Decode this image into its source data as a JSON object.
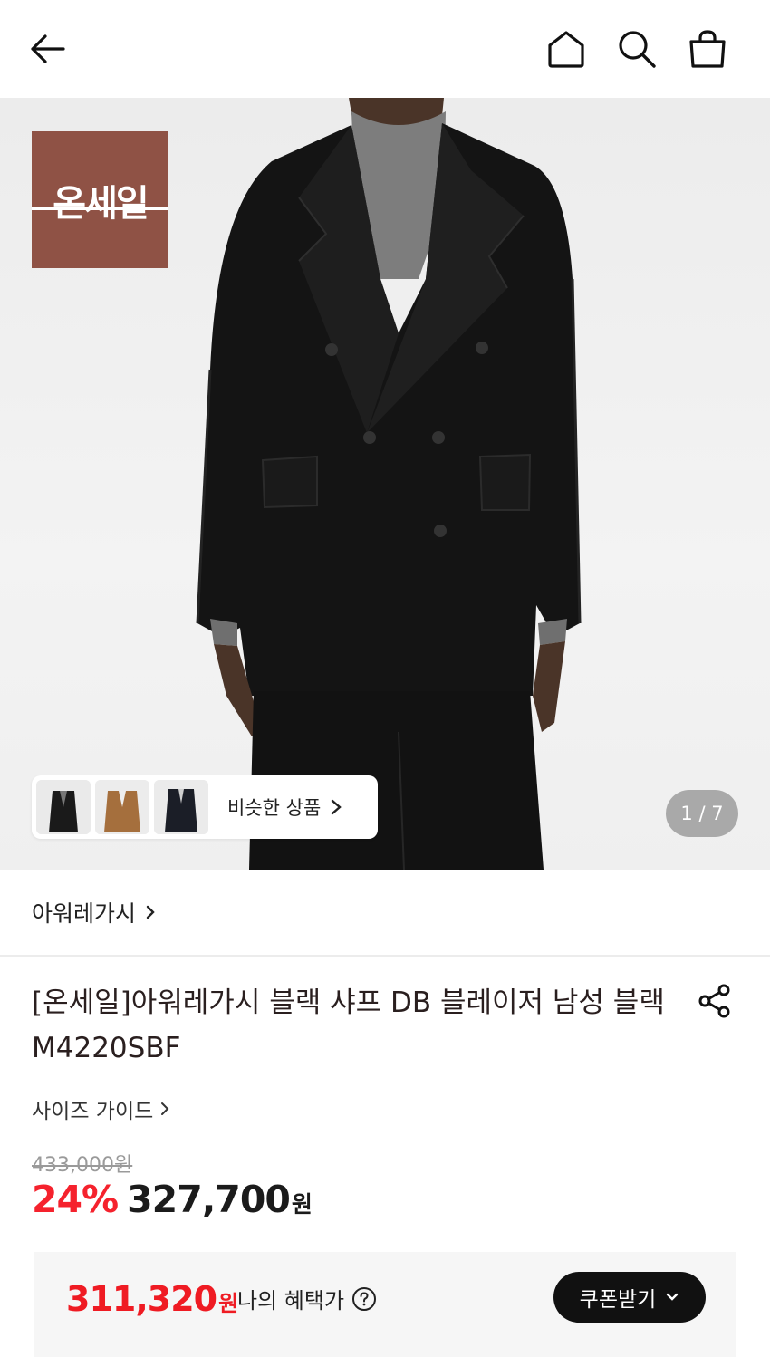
{
  "header": {
    "back_icon": "arrow-left-icon",
    "home_icon": "home-icon",
    "search_icon": "search-icon",
    "bag_icon": "shopping-bag-icon"
  },
  "hero": {
    "badge_text": "온세일",
    "badge_color": "#8f5245",
    "similar_label": "비슷한 상품",
    "page_indicator": "1 / 7"
  },
  "product": {
    "brand": "아워레가시",
    "title": "[온세일]아워레가시 블랙 샤프 DB 블레이저 남성 블랙 M4220SBF",
    "size_guide": "사이즈 가이드",
    "original_price": "433,000원",
    "discount": "24%",
    "sale_price": "327,700",
    "currency": "원"
  },
  "benefit": {
    "price": "311,320",
    "currency": "원",
    "label": "나의 혜택가",
    "coupon_button": "쿠폰받기"
  },
  "colors": {
    "accent_red": "#ef1b23",
    "button_dark": "#111111"
  }
}
